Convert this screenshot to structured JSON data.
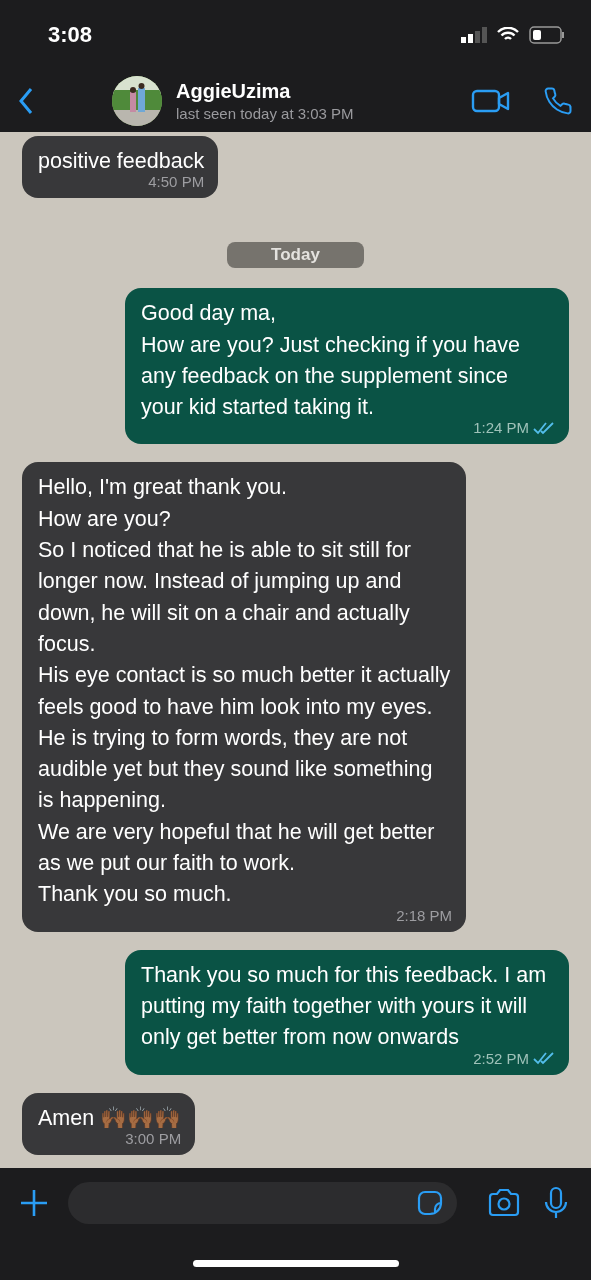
{
  "status_bar": {
    "time": "3:08"
  },
  "header": {
    "contact_name": "AggieUzima",
    "last_seen": "last seen today at 3:03 PM"
  },
  "messages": [
    {
      "kind": "incoming",
      "text": "positive feedback",
      "time": "4:50 PM"
    },
    {
      "kind": "date",
      "text": "Today"
    },
    {
      "kind": "outgoing",
      "text": "Good day ma,\nHow are you? Just checking if you have any feedback on the supplement since your kid started taking it.",
      "time": "1:24 PM",
      "read": true
    },
    {
      "kind": "incoming",
      "text": "Hello, I'm great thank you.\nHow are you?\nSo I noticed that he is able to sit still for longer now. Instead of jumping up and down, he will sit on a chair and actually focus.\nHis eye contact is so much better it actually feels good to have him look into my eyes.\nHe is trying to form words, they are not audible yet but they sound like something is happening.\nWe are very hopeful that he will get better as we put our faith to work.\nThank you so much.",
      "time": "2:18 PM"
    },
    {
      "kind": "outgoing",
      "text": "Thank you so much for this feedback. I am putting my faith together with yours it will only get better from now onwards",
      "time": "2:52 PM",
      "read": true
    },
    {
      "kind": "incoming",
      "text": "Amen 🙌🏾🙌🏾🙌🏾",
      "time": "3:00 PM"
    }
  ]
}
